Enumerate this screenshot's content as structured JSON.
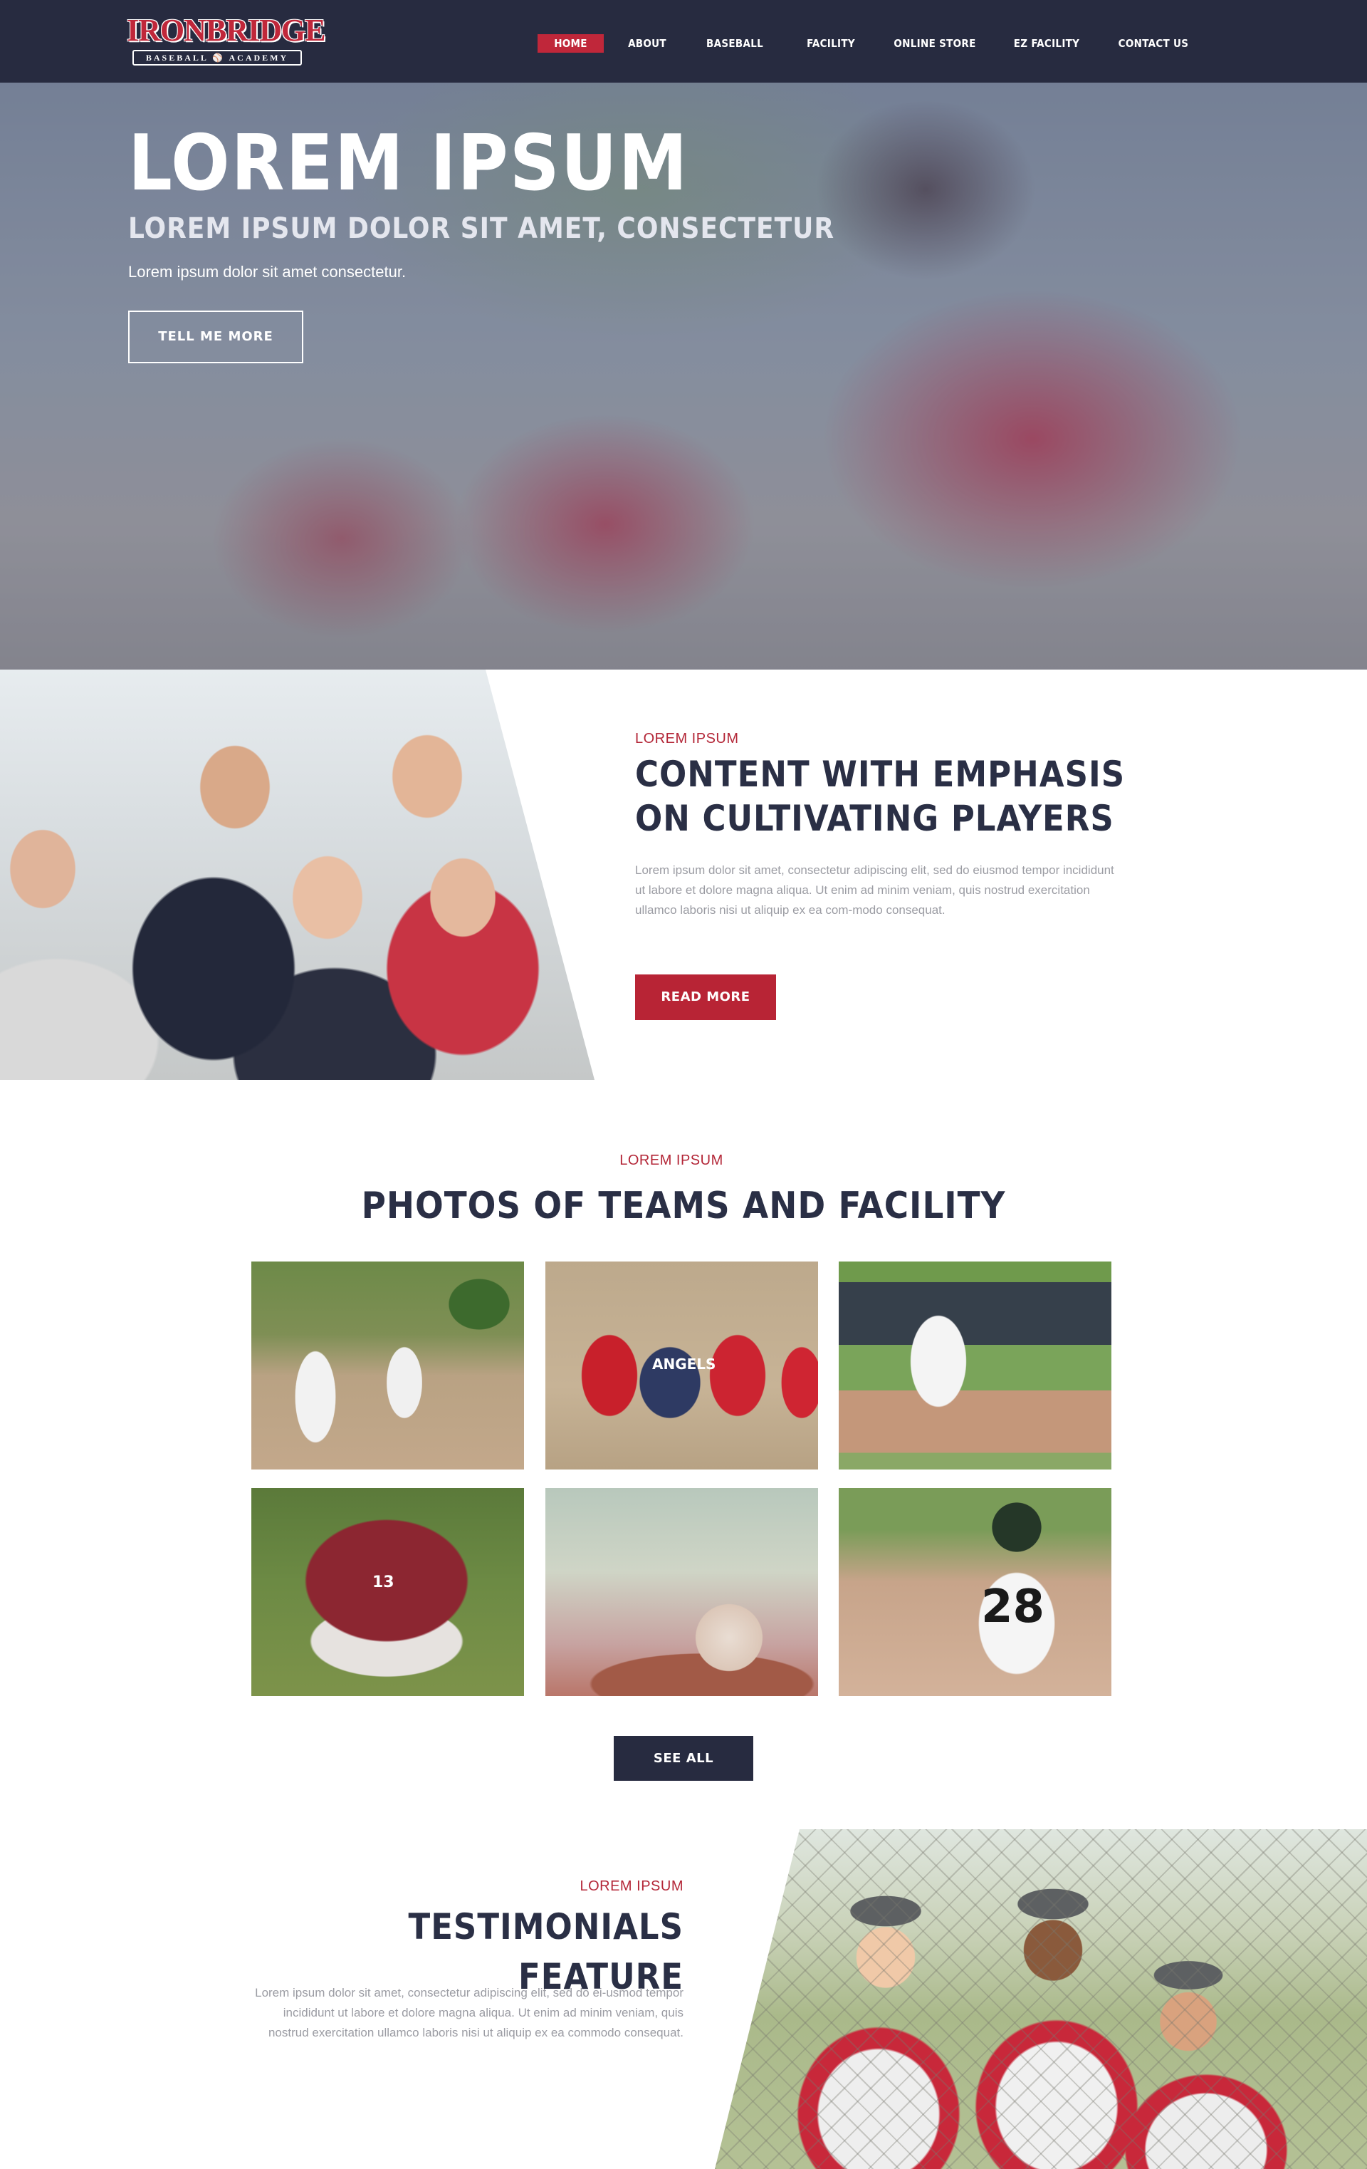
{
  "brand": {
    "logo_word": "IRONBRIDGE",
    "logo_sub": "BASEBALL ⚾ ACADEMY"
  },
  "nav": {
    "items": [
      {
        "label": "HOME",
        "active": true
      },
      {
        "label": "ABOUT",
        "active": false
      },
      {
        "label": "BASEBALL",
        "active": false
      },
      {
        "label": "FACILITY",
        "active": false
      },
      {
        "label": "ONLINE STORE",
        "active": false
      },
      {
        "label": "EZ FACILITY",
        "active": false
      },
      {
        "label": "CONTACT US",
        "active": false
      }
    ]
  },
  "hero": {
    "title": "LOREM IPSUM",
    "subtitle": "LOREM IPSUM DOLOR SIT AMET, CONSECTETUR",
    "text": "Lorem ipsum dolor sit amet consectetur.",
    "button": "TELL ME MORE"
  },
  "about": {
    "eyebrow": "LOREM IPSUM",
    "title": "CONTENT WITH EMPHASIS ON CULTIVATING PLAYERS",
    "body": "Lorem ipsum dolor sit amet, consectetur adipiscing elit, sed do eiusmod tempor incididunt ut labore et dolore magna aliqua. Ut enim ad minim veniam, quis nostrud exercitation ullamco laboris nisi ut aliquip ex ea com-modo consequat.",
    "button": "READ MORE"
  },
  "gallery": {
    "eyebrow": "LOREM IPSUM",
    "title": "PHOTOS OF TEAMS AND FACILITY",
    "photos": [
      "",
      "ANGELS",
      "",
      "13",
      "",
      "28"
    ],
    "button": "SEE ALL"
  },
  "testimonials": {
    "eyebrow": "LOREM IPSUM",
    "title": "TESTIMONIALS FEATURE",
    "body": "Lorem ipsum dolor sit amet, consectetur adipiscing elit, sed do ei-usmod tempor incididunt ut labore et dolore magna aliqua. Ut enim ad minim veniam, quis nostrud exercitation ullamco laboris nisi ut aliquip ex ea commodo consequat."
  },
  "colors": {
    "navy": "#272b40",
    "accent_red": "#b82435",
    "heading": "#2a2f45",
    "body_text": "#9b9ca3"
  }
}
